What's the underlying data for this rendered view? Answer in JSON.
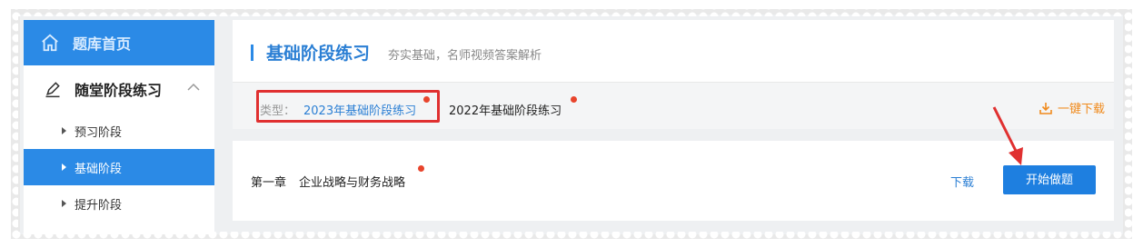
{
  "sidebar": {
    "home_label": "题库首页",
    "section_label": "随堂阶段练习",
    "items": [
      {
        "label": "预习阶段",
        "active": false
      },
      {
        "label": "基础阶段",
        "active": true
      },
      {
        "label": "提升阶段",
        "active": false
      }
    ]
  },
  "header": {
    "title": "基础阶段练习",
    "subtitle": "夯实基础，名师视频答案解析"
  },
  "type_filter": {
    "label": "类型：",
    "options": [
      "2023年基础阶段练习",
      "2022年基础阶段练习"
    ],
    "selected": "2023年基础阶段练习",
    "download_all": "一键下载"
  },
  "chapter": {
    "number": "第一章",
    "name": "企业战略与财务战略",
    "download_label": "下载",
    "start_label": "开始做题"
  },
  "colors": {
    "accent": "#2b8ae6",
    "highlight_box": "#e03030",
    "dot": "#e8442c",
    "download_orange": "#f08a1c"
  }
}
